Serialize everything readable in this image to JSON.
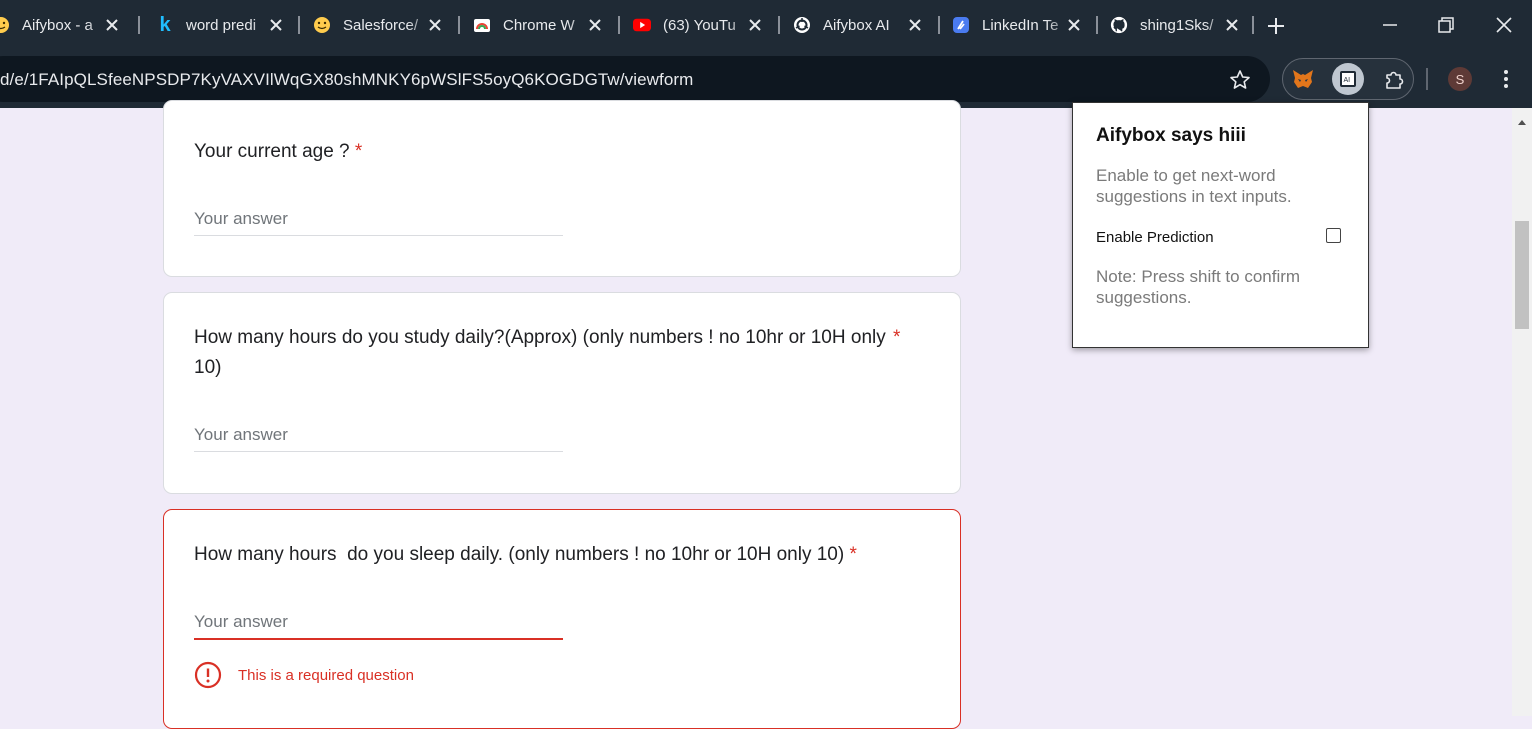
{
  "browser": {
    "tabs": [
      {
        "title": "Aifybox - a",
        "icon": "huggingface-icon"
      },
      {
        "title": "word predi",
        "icon": "kaggle-k-icon"
      },
      {
        "title": "Salesforce/",
        "icon": "huggingface-icon"
      },
      {
        "title": "Chrome W",
        "icon": "chrome-web-store-icon"
      },
      {
        "title": "(63) YouTu",
        "icon": "youtube-icon"
      },
      {
        "title": "Aifybox AI",
        "icon": "openai-icon"
      },
      {
        "title": "LinkedIn Te",
        "icon": "linkedin-tool-icon"
      },
      {
        "title": "shing1Sks/",
        "icon": "github-icon"
      }
    ],
    "url": "d/e/1FAIpQLSfeeNPSDP7KyVAXVIlWqGX80shMNKY6pWSlFS5oyQ6KOGDGTw/viewform",
    "profile_initial": "S",
    "colors": {
      "frame": "#1f2a35",
      "omnibox": "#0e1720"
    }
  },
  "form": {
    "questions": [
      {
        "text": "Your current age ?",
        "required_mark": "*",
        "placeholder": "Your answer"
      },
      {
        "text_line1": "How many hours do you study daily?(Approx) (only numbers ! no 10hr or 10H only",
        "text_line2": "10)",
        "required_mark": "*",
        "placeholder": "Your answer"
      },
      {
        "text": "How many hours  do you sleep daily. (only numbers ! no 10hr or 10H only 10)",
        "required_mark": "*",
        "placeholder": "Your answer",
        "error": "This is a required question"
      }
    ],
    "colors": {
      "background": "#f0ebf8",
      "error": "#d93025"
    }
  },
  "popup": {
    "title": "Aifybox says hiii",
    "description": "Enable to get next-word suggestions in text inputs.",
    "toggle_label": "Enable Prediction",
    "toggle_checked": false,
    "note": "Note: Press shift to confirm suggestions."
  }
}
